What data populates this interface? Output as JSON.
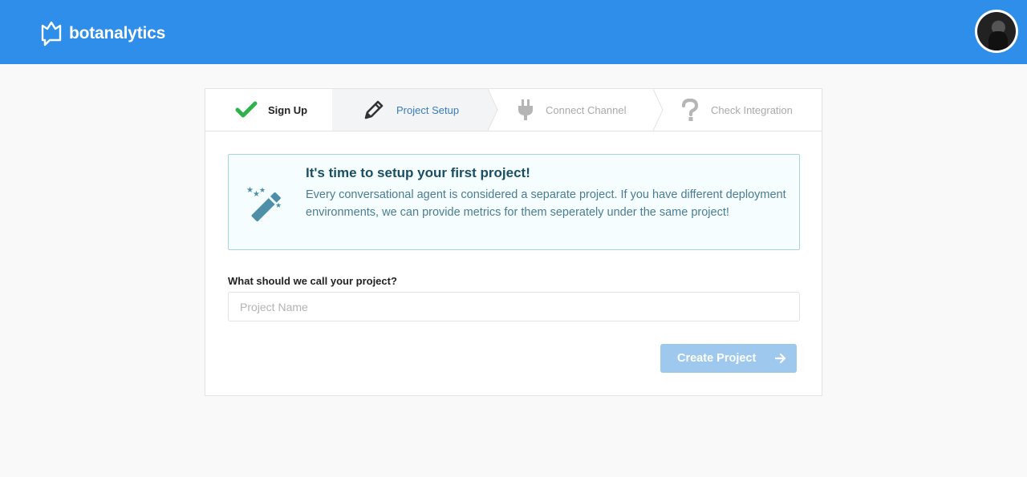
{
  "header": {
    "brand": "botanalytics",
    "logo_icon": "chat-bubble-logo-icon",
    "avatar_icon": "user-avatar"
  },
  "steps": [
    {
      "label": "Sign Up",
      "icon": "checkmark-icon",
      "state": "completed"
    },
    {
      "label": "Project Setup",
      "icon": "pencil-icon",
      "state": "active"
    },
    {
      "label": "Connect Channel",
      "icon": "plug-icon",
      "state": "pending"
    },
    {
      "label": "Check Integration",
      "icon": "question-icon",
      "state": "pending"
    }
  ],
  "info": {
    "icon": "magic-wand-icon",
    "title": "It's time to setup your first project!",
    "body": "Every conversational agent is considered a separate project. If you have different deployment environments, we can provide metrics for them seperately under the same project!"
  },
  "form": {
    "label": "What should we call your project?",
    "placeholder": "Project Name",
    "value": ""
  },
  "actions": {
    "create_label": "Create Project",
    "create_icon": "arrow-right-icon"
  },
  "colors": {
    "header_bg": "#2e8ee9",
    "check_green": "#2fb24c",
    "active_step_text": "#3a7bbf",
    "button_disabled": "#9ec8ee",
    "info_bg": "#f5fdfe",
    "info_border": "#a7d4df"
  }
}
